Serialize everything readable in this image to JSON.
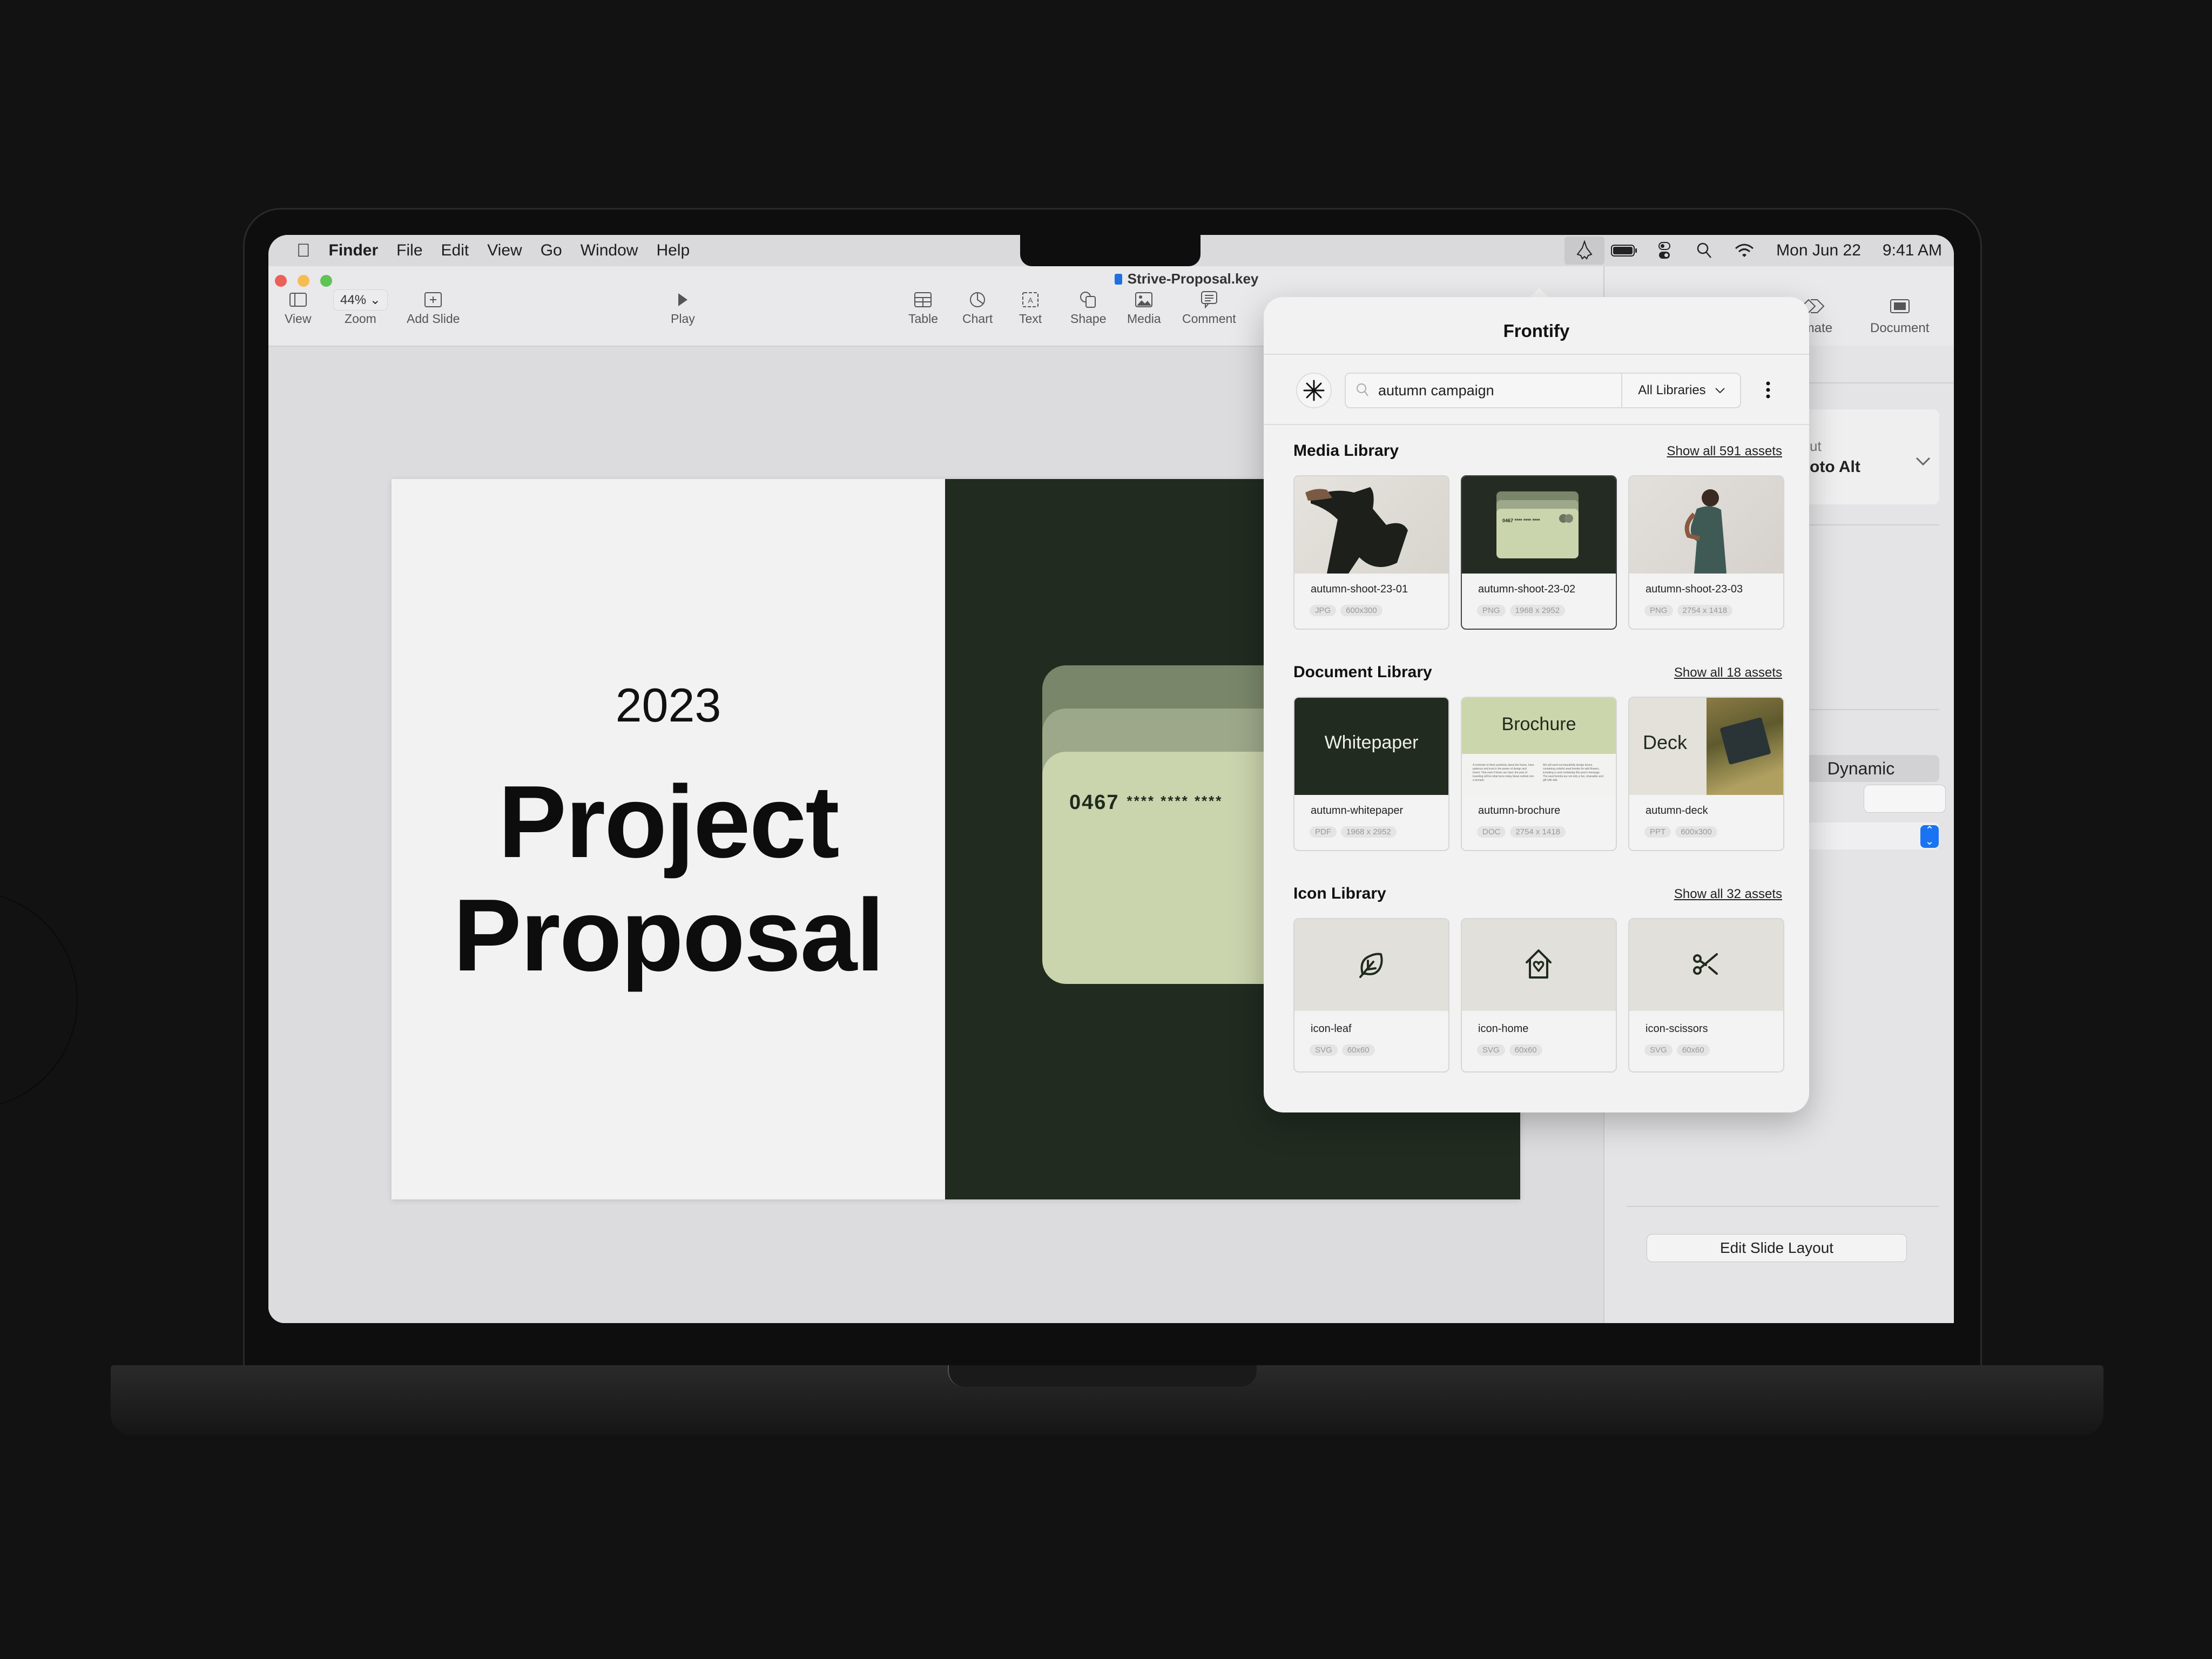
{
  "menubar": {
    "app_name": "Finder",
    "menus": [
      "File",
      "Edit",
      "View",
      "Go",
      "Window",
      "Help"
    ],
    "status_icons": [
      "frontify-icon",
      "battery-icon",
      "control-center-icon",
      "spotlight-icon",
      "wifi-icon"
    ],
    "date": "Mon Jun 22",
    "time": "9:41 AM"
  },
  "window": {
    "document_title": "Strive-Proposal.key",
    "toolbar": {
      "view_label": "View",
      "zoom_label": "Zoom",
      "zoom_value": "44%",
      "add_slide_label": "Add Slide",
      "play_label": "Play",
      "insert_items": [
        {
          "label": "Table",
          "icon": "table-icon"
        },
        {
          "label": "Chart",
          "icon": "chart-icon"
        },
        {
          "label": "Text",
          "icon": "text-box-icon"
        },
        {
          "label": "Shape",
          "icon": "shape-icon"
        },
        {
          "label": "Media",
          "icon": "media-icon"
        },
        {
          "label": "Comment",
          "icon": "comment-icon"
        }
      ],
      "inspector_tabs": [
        {
          "label": "Animate",
          "visible_label": "nimate",
          "icon": "animate-icon"
        },
        {
          "label": "Document",
          "icon": "document-icon"
        }
      ]
    }
  },
  "slide": {
    "year": "2023",
    "title_line1": "Project",
    "title_line2": "Proposal",
    "card_number": "0467",
    "card_masked": "****  ****  ****",
    "colors": {
      "dark": "#212b20",
      "card_light": "#cad4ad",
      "card_mid": "#9da88a",
      "card_back": "#7a8669"
    }
  },
  "inspector": {
    "layout_label_partial": "ut",
    "layout_value_partial": "oto Alt",
    "segment_value": "Dynamic",
    "edit_layout_button": "Edit Slide Layout"
  },
  "frontify": {
    "title": "Frontify",
    "search_value": "autumn campaign",
    "search_placeholder": "Search",
    "library_filter": "All Libraries",
    "sections": [
      {
        "title": "Media Library",
        "link": "Show all 591 assets",
        "assets": [
          {
            "name": "autumn-shoot-23-01",
            "type": "JPG",
            "size": "600x300",
            "selected": false
          },
          {
            "name": "autumn-shoot-23-02",
            "type": "PNG",
            "size": "1968 x 2952",
            "selected": true
          },
          {
            "name": "autumn-shoot-23-03",
            "type": "PNG",
            "size": "2754 x 1418",
            "selected": false
          }
        ]
      },
      {
        "title": "Document Library",
        "link": "Show all 18 assets",
        "assets": [
          {
            "name": "autumn-whitepaper",
            "type": "PDF",
            "size": "1968 x 2952",
            "thumb_label": "Whitepaper"
          },
          {
            "name": "autumn-brochure",
            "type": "DOC",
            "size": "2754 x 1418",
            "thumb_label": "Brochure"
          },
          {
            "name": "autumn-deck",
            "type": "PPT",
            "size": "600x300",
            "thumb_label": "Deck"
          }
        ]
      },
      {
        "title": "Icon Library",
        "link": "Show all 32 assets",
        "assets": [
          {
            "name": "icon-leaf",
            "type": "SVG",
            "size": "60x60",
            "icon": "leaf-icon"
          },
          {
            "name": "icon-home",
            "type": "SVG",
            "size": "60x60",
            "icon": "home-heart-icon"
          },
          {
            "name": "icon-scissors",
            "type": "SVG",
            "size": "60x60",
            "icon": "scissors-icon"
          }
        ]
      }
    ],
    "brochure_text_col1": "A reminder to think positively about the future, have patience and trust in the power of design and brand. That even if times are hard, the pow of branding will be what turns today bleak outlook into a triumph.",
    "brochure_text_col2": "We will send out beautifully design boxes, containing colorful seed bombs for wild flowers, including a card containing this year's message. The seed bombs are not only a fun, shareable and gift with talk."
  }
}
